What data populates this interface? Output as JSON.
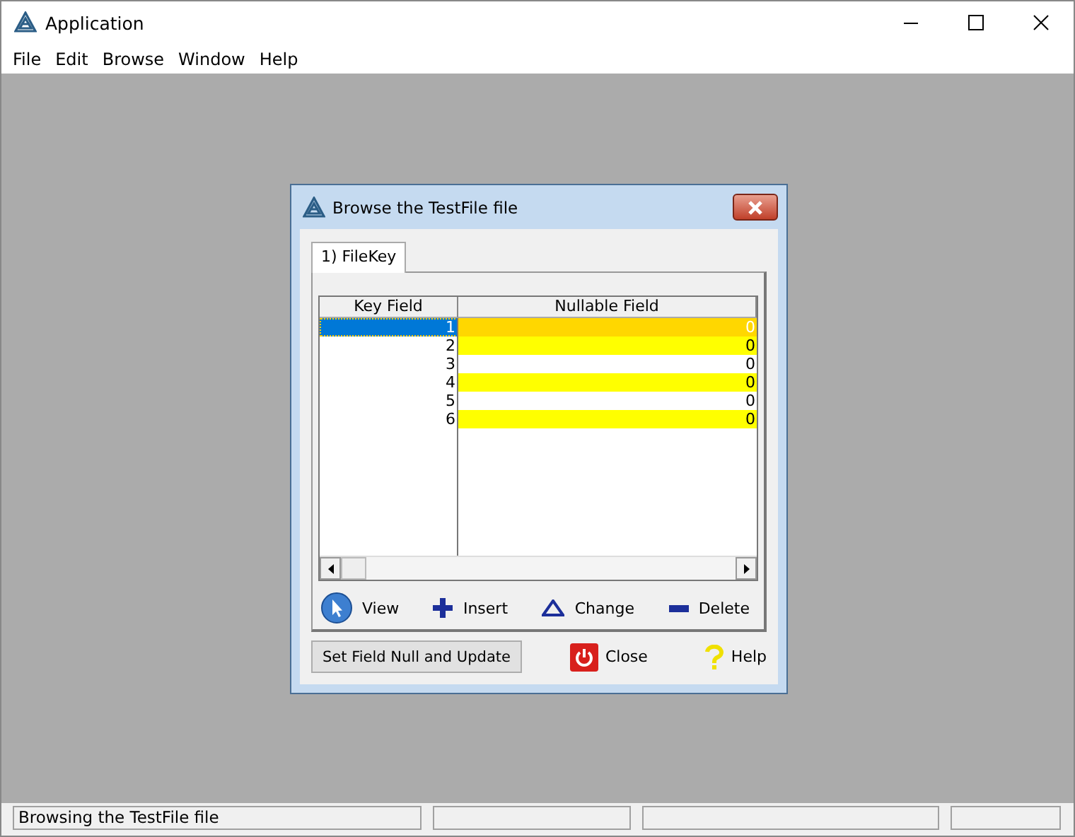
{
  "window": {
    "title": "Application"
  },
  "menu": [
    "File",
    "Edit",
    "Browse",
    "Window",
    "Help"
  ],
  "dialog": {
    "title": "Browse the TestFile file",
    "tabs": [
      {
        "label": "1) FileKey",
        "selected": true
      }
    ],
    "table": {
      "columns": [
        "Key Field",
        "Nullable Field"
      ],
      "rows": [
        {
          "cells": [
            "1",
            "0"
          ],
          "selected": true,
          "highlighted": true
        },
        {
          "cells": [
            "2",
            "0"
          ],
          "selected": false,
          "highlighted": true
        },
        {
          "cells": [
            "3",
            "0"
          ],
          "selected": false,
          "highlighted": false
        },
        {
          "cells": [
            "4",
            "0"
          ],
          "selected": false,
          "highlighted": true
        },
        {
          "cells": [
            "5",
            "0"
          ],
          "selected": false,
          "highlighted": false
        },
        {
          "cells": [
            "6",
            "0"
          ],
          "selected": false,
          "highlighted": true
        }
      ]
    },
    "actions": [
      {
        "kind": "view",
        "label": "View"
      },
      {
        "kind": "insert",
        "label": "Insert"
      },
      {
        "kind": "change",
        "label": "Change"
      },
      {
        "kind": "delete",
        "label": "Delete"
      }
    ],
    "buttons": [
      {
        "kind": "plain",
        "label": "Set Field Null and Update"
      },
      {
        "kind": "close",
        "label": "Close"
      },
      {
        "kind": "help",
        "label": "Help"
      }
    ]
  },
  "status_bar": [
    "Browsing the TestFile file"
  ]
}
